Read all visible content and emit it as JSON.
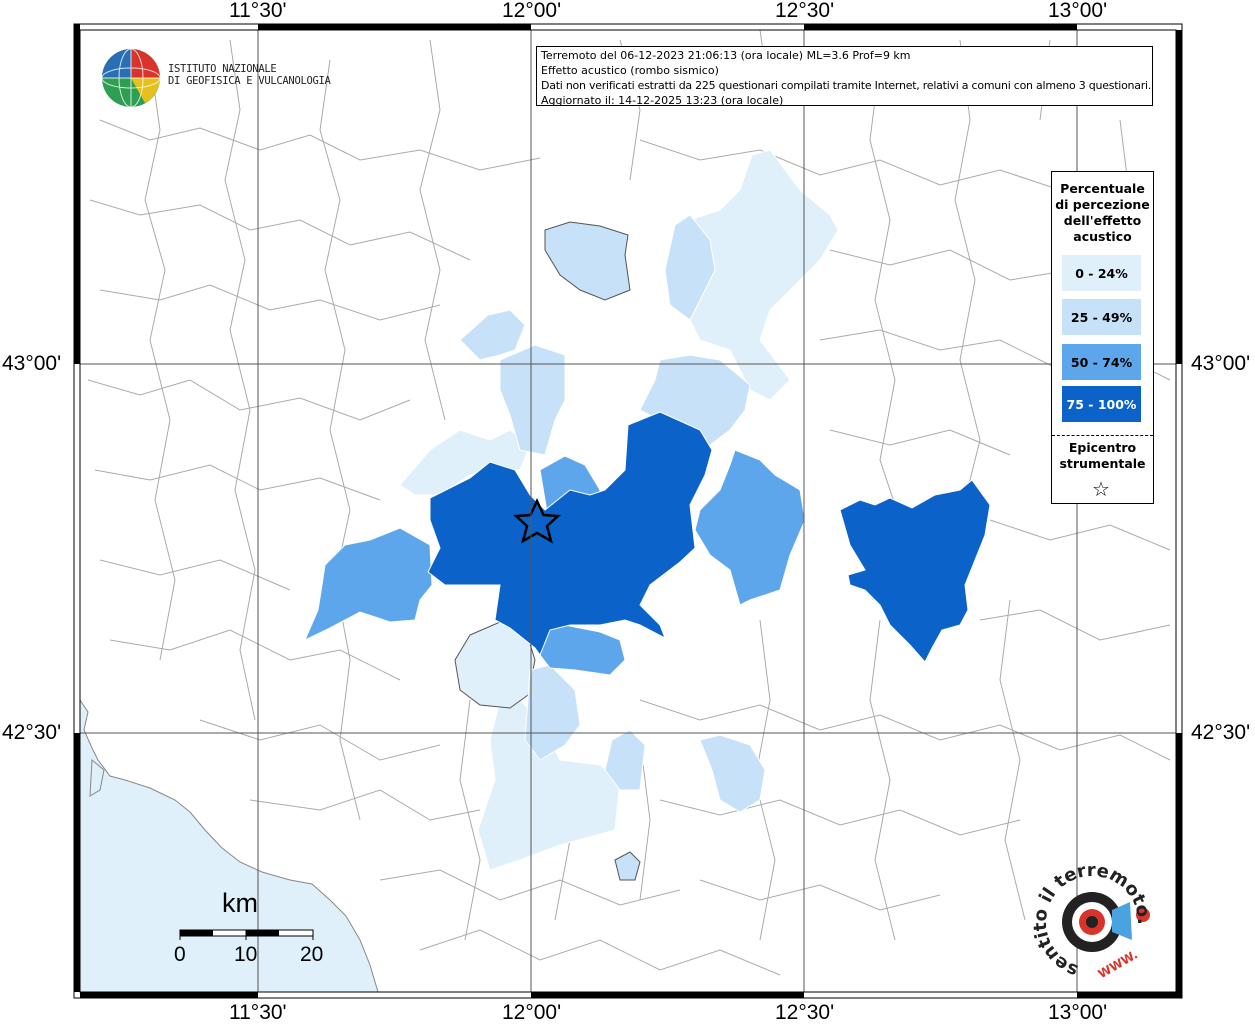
{
  "map": {
    "title_lines": [
      "Terremoto del 06-12-2023 21:06:13 (ora locale) ML=3.6 Prof=9 km",
      "Effetto acustico (rombo sismico)",
      "Dati non verificati estratti da 225 questionari compilati tramite Internet, relativi a comuni con almeno 3 questionari.",
      "Aggiornato il: 14-12-2025 13:23 (ora locale)"
    ],
    "longitude_ticks": [
      "11°30'",
      "12°00'",
      "12°30'",
      "13°00'"
    ],
    "latitude_ticks": [
      "43°00'",
      "42°30'"
    ]
  },
  "institution": {
    "line1": "ISTITUTO NAZIONALE",
    "line2": "DI GEOFISICA E VULCANOLOGIA"
  },
  "legend": {
    "title_lines": [
      "Percentuale",
      "di percezione",
      "dell'effetto",
      "acustico"
    ],
    "classes": [
      {
        "label": "0 - 24%",
        "color": "#e0f0fb",
        "text_color": "#000000"
      },
      {
        "label": "25 - 49%",
        "color": "#c6e1f8",
        "text_color": "#000000"
      },
      {
        "label": "50 - 74%",
        "color": "#5ea6ec",
        "text_color": "#000000"
      },
      {
        "label": "75 - 100%",
        "color": "#0b62c8",
        "text_color": "#ffffff"
      }
    ],
    "epicenter_lines": [
      "Epicentro",
      "strumentale"
    ],
    "epicenter_symbol": "☆"
  },
  "scale_bar": {
    "unit": "km",
    "labels": [
      "0",
      "10",
      "20"
    ]
  },
  "brand": {
    "text_main": "hai sentito il terremoto.it",
    "text_www": "WWW.",
    "icon": "loudspeaker-icon"
  },
  "colors": {
    "sea": "#dff0fb",
    "grid": "#555555",
    "boundary": "#aaaaaa"
  }
}
